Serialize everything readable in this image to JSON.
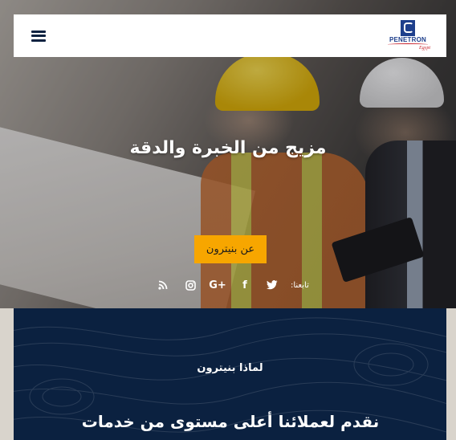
{
  "header": {
    "logo_text": "PENETRON",
    "logo_sub": "Egypt",
    "menu_icon": "hamburger-menu-icon"
  },
  "hero": {
    "title": "مزيج من الخبرة والدقة",
    "cta_label": "عن بنيترون",
    "follow_label": "تابعنا:",
    "social": [
      {
        "icon": "rss-icon"
      },
      {
        "icon": "instagram-icon"
      },
      {
        "icon": "google-plus-icon",
        "label": "G+"
      },
      {
        "icon": "facebook-icon",
        "label": "f"
      },
      {
        "icon": "twitter-icon"
      }
    ]
  },
  "why": {
    "kicker": "لماذا بنيترون",
    "heading": "نقدم لعملائنا أعلى مستوى من خدمات"
  },
  "colors": {
    "accent": "#f7a600",
    "navy": "#0b2140",
    "brand_blue": "#1e3f8c",
    "brand_red": "#c8202a"
  }
}
